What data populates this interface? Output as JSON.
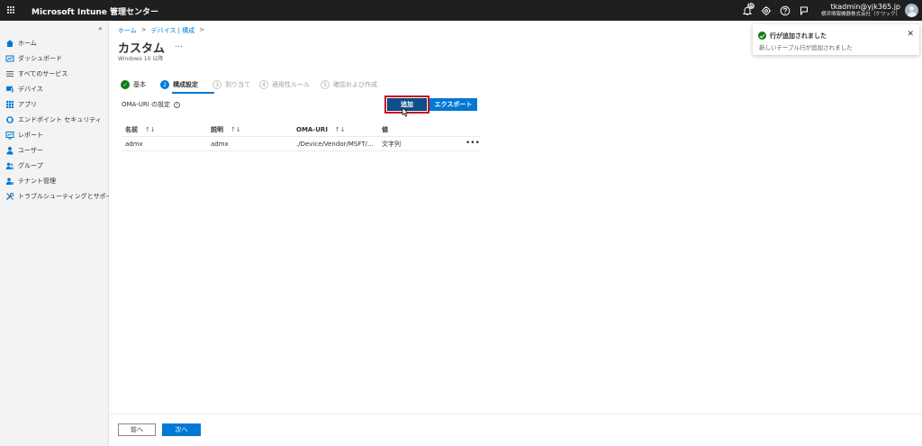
{
  "topbar": {
    "title": "Microsoft Intune 管理センター",
    "notification_count": "10",
    "user_email": "tkadmin@yjk365.jp",
    "user_org": "横浜情報機器株式会社（ケワック）"
  },
  "sidebar": {
    "collapse": "«",
    "items": [
      {
        "label": "ホーム",
        "icon": "home-icon"
      },
      {
        "label": "ダッシュボード",
        "icon": "dashboard-icon"
      },
      {
        "label": "すべてのサービス",
        "icon": "all-services-icon"
      },
      {
        "label": "デバイス",
        "icon": "devices-icon"
      },
      {
        "label": "アプリ",
        "icon": "apps-icon"
      },
      {
        "label": "エンドポイント セキュリティ",
        "icon": "endpoint-security-icon"
      },
      {
        "label": "レポート",
        "icon": "reports-icon"
      },
      {
        "label": "ユーザー",
        "icon": "users-icon"
      },
      {
        "label": "グループ",
        "icon": "groups-icon"
      },
      {
        "label": "テナント管理",
        "icon": "tenant-admin-icon"
      },
      {
        "label": "トラブルシューティングとサポート",
        "icon": "troubleshooting-icon"
      }
    ]
  },
  "breadcrumb": {
    "home": "ホーム",
    "sep1": ">",
    "devices": "デバイス | 構成",
    "sep2": ">"
  },
  "page": {
    "title": "カスタム",
    "more": "…",
    "subtitle": "Windows 10 以降"
  },
  "steps": [
    {
      "number": "✓",
      "label": "基本",
      "state": "done"
    },
    {
      "number": "2",
      "label": "構成設定",
      "state": "active"
    },
    {
      "number": "3",
      "label": "割り当て",
      "state": "pending"
    },
    {
      "number": "4",
      "label": "適用性ルール",
      "state": "pending"
    },
    {
      "number": "5",
      "label": "確認および作成",
      "state": "pending"
    }
  ],
  "section": {
    "label": "OMA-URI の設定",
    "info": "i",
    "add_label": "追加",
    "export_label": "エクスポート"
  },
  "table": {
    "headers": [
      "名前",
      "説明",
      "OMA-URI",
      "値"
    ],
    "sort_glyph": "↑↓",
    "rows": [
      {
        "name": "admx",
        "description": "admx",
        "oma_uri": "./Device/Vendor/MSFT/…",
        "value": "文字列",
        "more": "•••"
      }
    ]
  },
  "footer": {
    "prev_label": "前へ",
    "next_label": "次へ"
  },
  "toast": {
    "title": "行が追加されました",
    "message": "新しいテーブル行が追加されました",
    "close": "✕"
  },
  "colors": {
    "accent": "#0078d4",
    "success": "#107c10",
    "highlight": "#c50f1f",
    "topbar": "#1f1f1f"
  }
}
